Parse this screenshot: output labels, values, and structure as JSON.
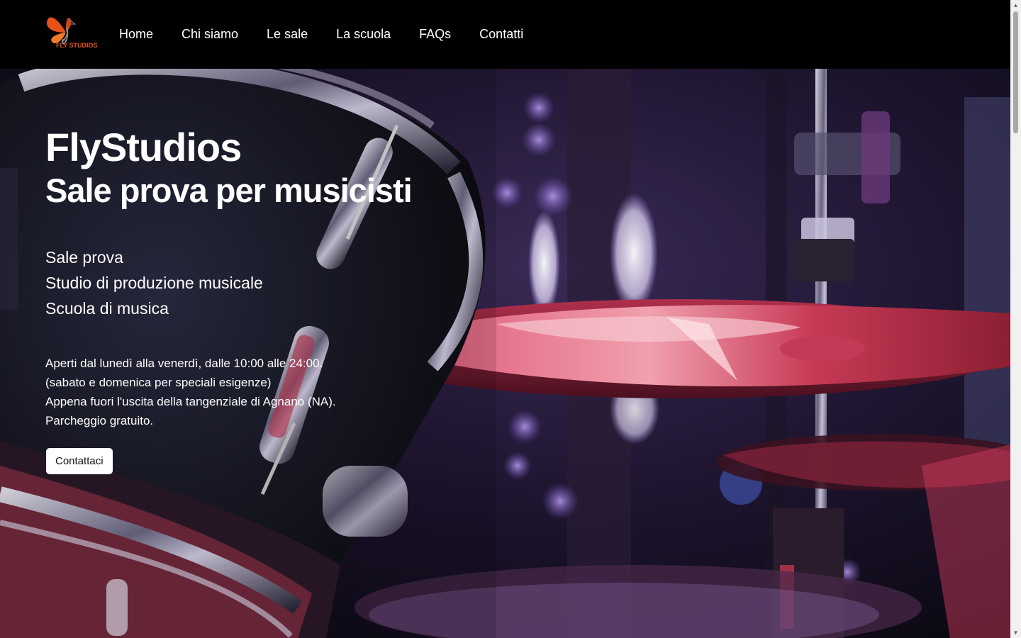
{
  "brand": {
    "logo_text": "FLY STUDIOS",
    "accent_color": "#e8501c"
  },
  "nav": {
    "items": [
      {
        "label": "Home"
      },
      {
        "label": "Chi siamo"
      },
      {
        "label": "Le sale"
      },
      {
        "label": "La scuola"
      },
      {
        "label": "FAQs"
      },
      {
        "label": "Contatti"
      }
    ]
  },
  "hero": {
    "title": "FlyStudios",
    "subtitle": "Sale prova per musicisti",
    "services": [
      "Sale prova",
      "Studio di produzione musicale",
      "Scuola di musica"
    ],
    "info": [
      "Aperti dal lunedì alla venerdì, dalle 10:00 alle 24:00.",
      "(sabato e domenica per speciali esigenze)",
      "Appena fuori l'uscita della tangenziale di Agnano (NA).",
      "Parcheggio gratuito."
    ],
    "cta_label": "Contattaci",
    "background_image": "drum-kit-photo"
  }
}
